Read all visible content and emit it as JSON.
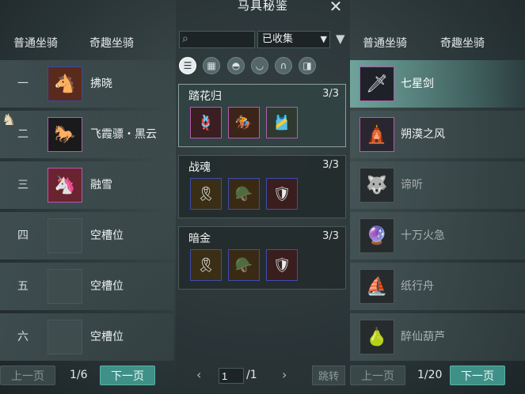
{
  "window": {
    "title": "马具秘鉴",
    "close_glyph": "✕"
  },
  "left_panel": {
    "tabs": [
      "普通坐骑",
      "奇趣坐骑"
    ],
    "items": [
      {
        "rank": "一",
        "name": "拂晓",
        "icon": "red-horse-icon",
        "glyph": "🐴"
      },
      {
        "rank": "二",
        "name": "飞霞骠・黑云",
        "icon": "black-horse-icon",
        "glyph": "🐎"
      },
      {
        "rank": "三",
        "name": "融雪",
        "icon": "white-horse-icon",
        "glyph": "🦄"
      },
      {
        "rank": "四",
        "name": "空槽位",
        "icon": "empty-slot-icon",
        "glyph": ""
      },
      {
        "rank": "五",
        "name": "空槽位",
        "icon": "empty-slot-icon",
        "glyph": ""
      },
      {
        "rank": "六",
        "name": "空槽位",
        "icon": "empty-slot-icon",
        "glyph": ""
      }
    ],
    "pager": {
      "prev": "上一页",
      "info": "1/6",
      "next": "下一页"
    }
  },
  "center_panel": {
    "search": {
      "placeholder": "",
      "value": ""
    },
    "filter": {
      "selected": "已收集"
    },
    "categories": [
      {
        "icon": "list-icon",
        "glyph": "☰",
        "active": true
      },
      {
        "icon": "grid-icon",
        "glyph": "▦",
        "active": false
      },
      {
        "icon": "saddle-icon",
        "glyph": "◓",
        "active": false
      },
      {
        "icon": "armor-icon",
        "glyph": "◡",
        "active": false
      },
      {
        "icon": "horseshoe-icon",
        "glyph": "∩",
        "active": false
      },
      {
        "icon": "rein-icon",
        "glyph": "◨",
        "active": false
      }
    ],
    "sets": [
      {
        "name": "踏花归",
        "count": "3/3",
        "gear": [
          "🪢",
          "🏇",
          "🎽"
        ]
      },
      {
        "name": "战魂",
        "count": "3/3",
        "gear": [
          "🎗",
          "🪖",
          "🛡"
        ]
      },
      {
        "name": "暗金",
        "count": "3/3",
        "gear": [
          "🎗",
          "🪖",
          "🛡"
        ]
      }
    ],
    "pager": {
      "prev_glyph": "‹",
      "next_glyph": "›",
      "page_value": "1",
      "total": "/1",
      "jump": "跳转"
    }
  },
  "right_panel": {
    "tabs": [
      "普通坐骑",
      "奇趣坐骑"
    ],
    "items": [
      {
        "name": "七星剑",
        "icon": "sword-icon",
        "glyph": "🗡"
      },
      {
        "name": "朔漠之风",
        "icon": "chariot-icon",
        "glyph": "🛕"
      },
      {
        "name": "谛听",
        "icon": "beast-icon",
        "glyph": "🐺"
      },
      {
        "name": "十万火急",
        "icon": "fire-orb-icon",
        "glyph": "🔮"
      },
      {
        "name": "纸行舟",
        "icon": "paper-boat-icon",
        "glyph": "⛵"
      },
      {
        "name": "醉仙葫芦",
        "icon": "gourd-icon",
        "glyph": "🍐"
      }
    ],
    "pager": {
      "prev": "上一页",
      "info": "1/20",
      "next": "下一页"
    }
  },
  "colors": {
    "accent": "#3f9187",
    "rare_border": "#3d4cb0",
    "epic_border": "#b35bb0"
  }
}
